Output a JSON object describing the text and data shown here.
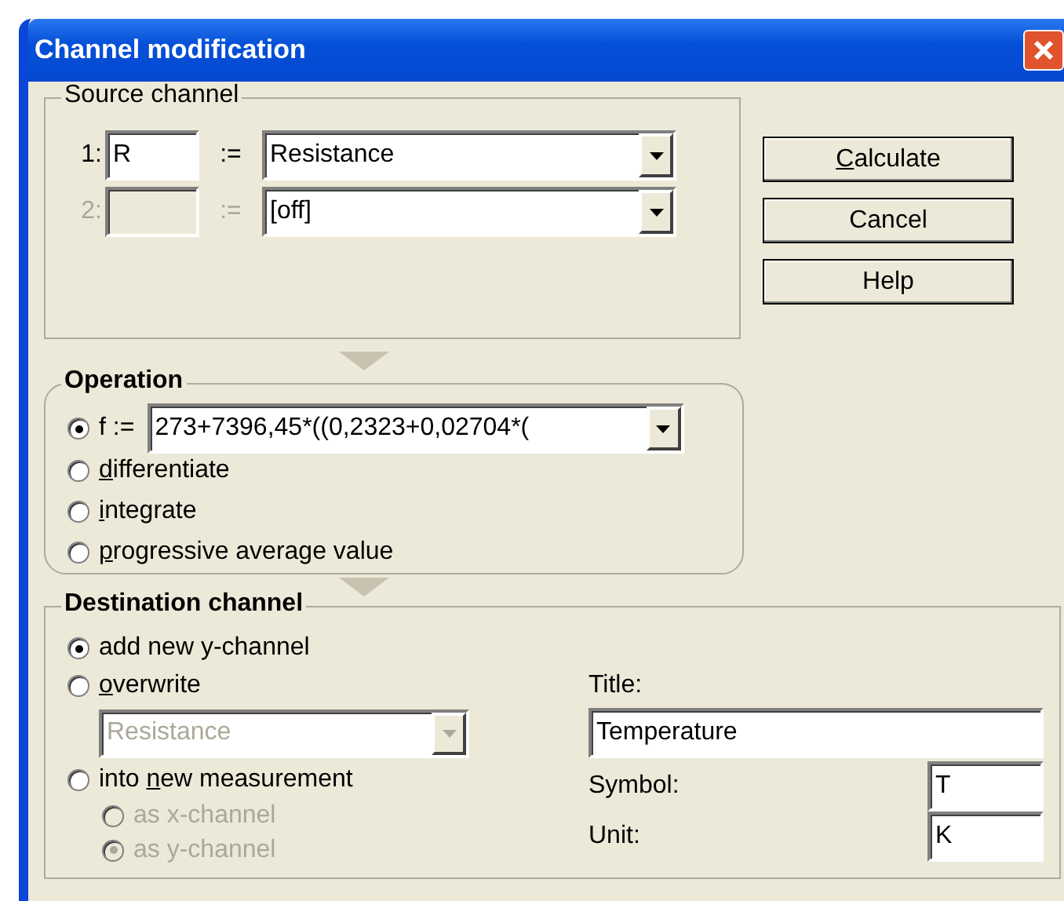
{
  "window": {
    "title": "Channel modification"
  },
  "source_channel": {
    "label": "Source channel",
    "rows": [
      {
        "index": "1:",
        "symbol": "R",
        "assign": ":=",
        "channel": "Resistance",
        "disabled": false
      },
      {
        "index": "2:",
        "assign": ":=",
        "channel": "[off]",
        "disabled": true
      }
    ]
  },
  "buttons": [
    {
      "label": [
        {
          "text": "C",
          "underline": true
        },
        {
          "text": "alculate",
          "underline": false
        }
      ]
    },
    {
      "label": [
        {
          "text": "Cancel",
          "underline": false
        }
      ]
    },
    {
      "label": [
        {
          "text": "Help",
          "underline": false
        }
      ]
    }
  ],
  "operation": {
    "label": "Operation",
    "options": [
      {
        "kind": "formula",
        "label": "f :=",
        "value": "273+7396,45*((0,2323+0,02704*(",
        "selected": true
      },
      {
        "kind": "plain",
        "label": [
          {
            "text": "d",
            "underline": true
          },
          {
            "text": "ifferentiate",
            "underline": false
          }
        ],
        "selected": false
      },
      {
        "kind": "plain",
        "label": [
          {
            "text": "i",
            "underline": true
          },
          {
            "text": "ntegrate",
            "underline": false
          }
        ],
        "selected": false
      },
      {
        "kind": "plain",
        "label": [
          {
            "text": "p",
            "underline": true
          },
          {
            "text": "rogressive average value",
            "underline": false
          }
        ],
        "selected": false
      }
    ]
  },
  "destination": {
    "label": "Destination channel",
    "options": [
      {
        "label": "add new y-channel",
        "selected": true,
        "disabled": false
      },
      {
        "label": [
          {
            "text": "o",
            "underline": true
          },
          {
            "text": "verwrite",
            "underline": false
          }
        ],
        "selected": false,
        "disabled": false,
        "dropdown": {
          "value": "Resistance",
          "disabled": true
        }
      },
      {
        "label": [
          {
            "text": "into ",
            "underline": false
          },
          {
            "text": "n",
            "underline": true
          },
          {
            "text": "ew measurement",
            "underline": false
          }
        ],
        "selected": false,
        "disabled": false,
        "children": [
          {
            "label": "as x-channel",
            "selected": false,
            "disabled": true
          },
          {
            "label": "as y-channel",
            "selected": true,
            "disabled": true
          }
        ]
      }
    ],
    "title": {
      "label": "Title:",
      "value": "Temperature"
    },
    "symbol": {
      "label": "Symbol:",
      "value": "T"
    },
    "unit": {
      "label": "Unit:",
      "value": "K"
    }
  }
}
